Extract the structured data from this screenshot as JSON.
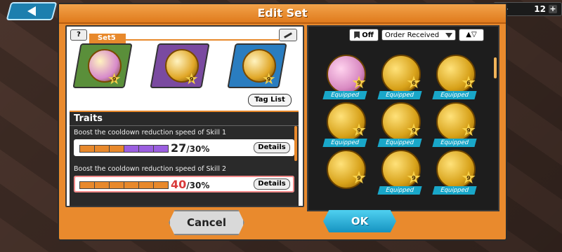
{
  "header": {
    "title": "Edit Set",
    "currency_amount": "12"
  },
  "set": {
    "help_label": "?",
    "name": "Set5",
    "tag_list_label": "Tag List",
    "members": [
      {
        "level": "9",
        "color": "#5a8f3a",
        "medal_color": "#d78acb"
      },
      {
        "level": "9",
        "color": "#7a4aa0",
        "medal_color": "#e0a626"
      },
      {
        "level": "9",
        "color": "#2a7dc0",
        "medal_color": "#e0a626"
      }
    ]
  },
  "traits": {
    "title": "Traits",
    "items": [
      {
        "description": "Boost the cooldown reduction speed of Skill 1",
        "value": "27",
        "max": "/30%",
        "value_color": "#222222",
        "details_label": "Details",
        "segments": [
          "#e8892c",
          "#e8892c",
          "#e8892c",
          "#9b5fe0",
          "#9b5fe0",
          "#9b5fe0"
        ]
      },
      {
        "description": "Boost the cooldown reduction speed of Skill 2",
        "value": "40",
        "max": "/30%",
        "value_color": "#d93a3a",
        "details_label": "Details",
        "segments": [
          "#e8892c",
          "#e8892c",
          "#e8892c",
          "#e8892c",
          "#e8892c",
          "#e8892c"
        ]
      }
    ]
  },
  "sort": {
    "bookmark_filter": "Off",
    "order": "Order Received"
  },
  "medals": [
    {
      "type": "pink",
      "level": "9",
      "equipped": "Equipped"
    },
    {
      "type": "gold",
      "level": "6",
      "equipped": "Equipped"
    },
    {
      "type": "gold",
      "level": "6",
      "equipped": "Equipped"
    },
    {
      "type": "gold",
      "level": "9",
      "equipped": "Equipped"
    },
    {
      "type": "gold",
      "level": "9",
      "equipped": "Equipped"
    },
    {
      "type": "gold",
      "level": "9",
      "equipped": "Equipped"
    },
    {
      "type": "gold",
      "level": "9",
      "equipped": ""
    },
    {
      "type": "gold",
      "level": "9",
      "equipped": "Equipped"
    },
    {
      "type": "gold",
      "level": "9",
      "equipped": "Equipped"
    }
  ],
  "buttons": {
    "cancel": "Cancel",
    "ok": "OK"
  }
}
